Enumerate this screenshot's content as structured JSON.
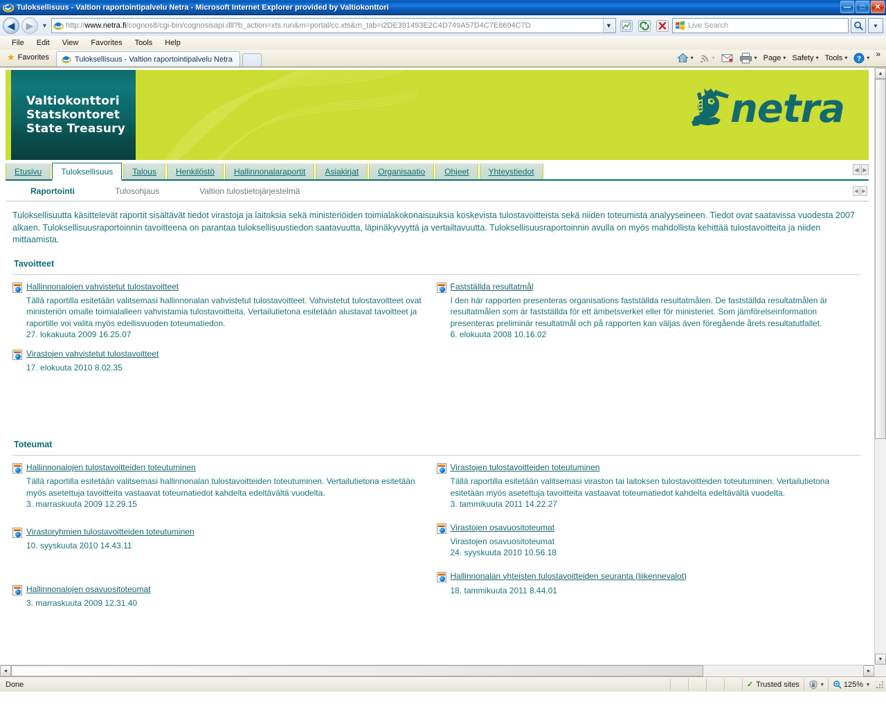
{
  "window": {
    "title": "Tuloksellisuus - Valtion raportointipalvelu Netra - Microsoft Internet Explorer provided by Valtiokonttori",
    "minimize_label": "—",
    "maximize_label": "□",
    "close_label": "✕"
  },
  "navbar": {
    "back_label": "◀",
    "forward_label": "▶",
    "recent_label": "▼",
    "url_proto": "http://",
    "url_host_pre": "www.",
    "url_host_bold": "netra.fi",
    "url_path": "/cognos8/cgi-bin/cognosisapi.dll?b_action=xts.run&m=portal/cc.xts&m_tab=i2DE391493E2C4D749A57D4C7E8694C7D",
    "address_dropdown_label": "▼",
    "compat_view_label": "⛰",
    "refresh_label": "↻",
    "stop_label": "✕",
    "search_placeholder": "Live Search",
    "search_go_label": "🔍",
    "search_dropdown_label": "▼"
  },
  "menubar": {
    "items": [
      "File",
      "Edit",
      "View",
      "Favorites",
      "Tools",
      "Help"
    ]
  },
  "favbar": {
    "favorites_label": "Favorites",
    "star_glyph": "★"
  },
  "tabs": {
    "open": [
      {
        "label": "Tuloksellisuus - Valtion raportointipalvelu Netra"
      }
    ],
    "new_tab_label": ""
  },
  "commandbar": {
    "items": [
      {
        "name": "home",
        "label": "",
        "caret": "▾"
      },
      {
        "name": "feeds",
        "label": "",
        "caret": "▾"
      },
      {
        "name": "read-mail",
        "label": "",
        "caret": ""
      },
      {
        "name": "print",
        "label": "",
        "caret": "▾"
      },
      {
        "name": "page",
        "label": "Page",
        "caret": "▾"
      },
      {
        "name": "safety",
        "label": "Safety",
        "caret": "▾"
      },
      {
        "name": "tools",
        "label": "Tools",
        "caret": "▾"
      },
      {
        "name": "help",
        "label": "",
        "caret": "▾"
      }
    ],
    "overflow_label": "»"
  },
  "banner": {
    "org_lines": [
      "Valtiokonttori",
      "Statskontoret",
      "State Treasury"
    ],
    "product_name": "netra",
    "bg_color": "#ccdd33",
    "teal_color": "#0d6e72"
  },
  "main_tabs": [
    {
      "label": "Etusivu",
      "active": false
    },
    {
      "label": "Tuloksellisuus",
      "active": true
    },
    {
      "label": "Talous",
      "active": false
    },
    {
      "label": "Henkilöstö",
      "active": false
    },
    {
      "label": "Hallinnonalaraportit",
      "active": false
    },
    {
      "label": "Asiakirjat",
      "active": false
    },
    {
      "label": "Organisaatio",
      "active": false
    },
    {
      "label": "Ohjeet",
      "active": false
    },
    {
      "label": "Yhteystiedot",
      "active": false
    }
  ],
  "tab_scroll": {
    "left_label": "◀",
    "right_label": "▶"
  },
  "sub_nav": [
    {
      "label": "Raportointi",
      "active": true
    },
    {
      "label": "Tulosohjaus",
      "active": false
    },
    {
      "label": "Valtion tulostietojärjestelmä",
      "active": false
    }
  ],
  "subnav_scroll": {
    "left_label": "◀",
    "right_label": "▶"
  },
  "content": {
    "intro": "Tuloksellisuutta käsittelevät raportit sisältävät tiedot virastoja ja laitoksia sekä ministeriöiden toimialakokonaisuuksia koskevista tulostavoitteista sekä niiden toteumista analyyseineen. Tiedot ovat saatavissa vuodesta 2007 alkaen. Tuloksellisuusraportoinnin tavoitteena on parantaa tuloksellisuustiedon saatavuutta, läpinäkyvyyttä ja vertailtavuutta. Tuloksellisuusraportoinnin avulla on myös mahdollista kehittää tulostavoitteita ja niiden mittaamista.",
    "sections": [
      {
        "title": "Tavoitteet",
        "left": [
          {
            "link": "Hallinnonalojen vahvistetut tulostavoitteet",
            "desc": "Tällä raportilla esitetään valitsemasi hallinnonalan vahvistetut tulostavoitteet. Vahvistetut tulostavoitteet ovat ministeriön omalle toimialalleen vahvistamia tulostavoitteita. Vertailutietona esitetään alustavat tavoitteet ja raportille voi valita myös edellisvuoden toteumatiedon.",
            "date": "27. lokakuuta 2009 16.25.07"
          },
          {
            "link": "Virastojen vahvistetut tulostavoitteet",
            "desc": "",
            "date": "17. elokuuta 2010 8.02.35"
          }
        ],
        "right": [
          {
            "link": "Fastställda resultatmål",
            "desc": "I den här rapporten presenteras organisations fastställda resultatmålen. De fastställda resultatmålen är resultatmålen som är fastställda för ett ämbetsverket eller för ministeriet. Som jämförelseinformation presenteras preliminär resultatmål och på rapporten kan väljas även föregående årets resultatutfallet.",
            "date": "6. elokuuta 2008 10.16.02"
          }
        ]
      },
      {
        "title": "Toteumat",
        "left": [
          {
            "link": "Hallinnonalojen tulostavoitteiden toteutuminen",
            "desc": "Tällä raportilla esitetään valitsemasi hallinnonalan tulostavoitteiden toteutuminen. Vertailutietona esitetään myös asetettuja tavoitteita vastaavat toteumatiedot kahdelta edeltävältä vuodelta.",
            "date": "3. marraskuuta 2009 12.29.15"
          },
          {
            "link": "Virastoryhmien tulostavoitteiden toteutuminen",
            "desc": "",
            "date": "10. syyskuuta 2010 14.43.11"
          },
          {
            "link": "Hallinnonalojen osavuositoteumat",
            "desc": "",
            "date": "3. marraskuuta 2009 12.31.40"
          }
        ],
        "right": [
          {
            "link": "Virastojen tulostavoitteiden toteutuminen",
            "desc": "Tällä raportilla esitetään valitsemasi viraston tai laitoksen tulostavoitteiden toteutuminen. Vertailutietona esitetään myös asetettuja tavoitteita vastaavat toteumatiedot kahdelta edeltävältä vuodelta.",
            "date": "3. tammikuuta 2011 14.22.27"
          },
          {
            "link": "Virastojen osavuositoteumat",
            "desc": "Virastojen osavuositoteumat",
            "date": "24. syyskuuta 2010 10.56.18"
          },
          {
            "link": "Hallinnonalan yhteisten tulostavoitteiden seuranta (liikennevalot)",
            "desc": "",
            "date": "18. tammikuuta 2011 8.44.01"
          }
        ]
      }
    ]
  },
  "statusbar": {
    "status": "Done",
    "zone_check": "✓",
    "zone": "Trusted sites",
    "protected_caret": "▾",
    "zoom": "125%",
    "zoom_caret": "▾"
  },
  "scrollbars": {
    "up_label": "▲",
    "down_label": "▼",
    "left_label": "◄",
    "right_label": "►"
  }
}
